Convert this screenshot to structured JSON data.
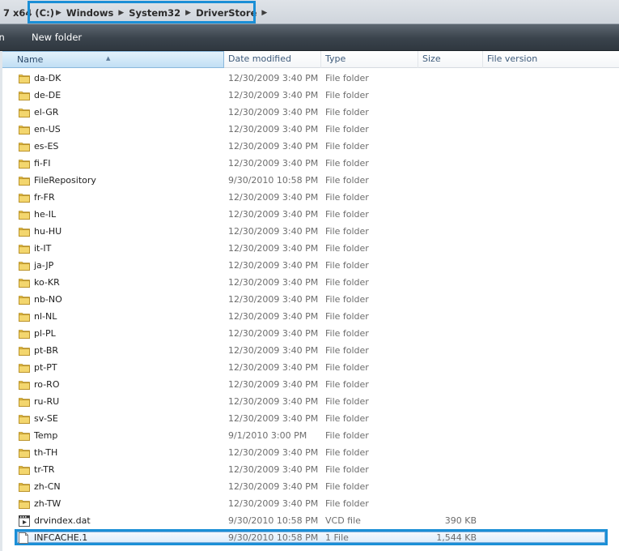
{
  "address": {
    "prefix": "7 x64 (C:)",
    "crumbs": [
      "Windows",
      "System32",
      "DriverStore"
    ]
  },
  "toolbar": {
    "left_fragment": "rn",
    "new_folder": "New folder"
  },
  "columns": {
    "name": "Name",
    "date": "Date modified",
    "type": "Type",
    "size": "Size",
    "version": "File version"
  },
  "files": [
    {
      "name": "da-DK",
      "date": "12/30/2009 3:40 PM",
      "type": "File folder",
      "size": "",
      "icon": "folder-icon"
    },
    {
      "name": "de-DE",
      "date": "12/30/2009 3:40 PM",
      "type": "File folder",
      "size": "",
      "icon": "folder-icon"
    },
    {
      "name": "el-GR",
      "date": "12/30/2009 3:40 PM",
      "type": "File folder",
      "size": "",
      "icon": "folder-icon"
    },
    {
      "name": "en-US",
      "date": "12/30/2009 3:40 PM",
      "type": "File folder",
      "size": "",
      "icon": "folder-icon"
    },
    {
      "name": "es-ES",
      "date": "12/30/2009 3:40 PM",
      "type": "File folder",
      "size": "",
      "icon": "folder-icon"
    },
    {
      "name": "fi-FI",
      "date": "12/30/2009 3:40 PM",
      "type": "File folder",
      "size": "",
      "icon": "folder-icon"
    },
    {
      "name": "FileRepository",
      "date": "9/30/2010 10:58 PM",
      "type": "File folder",
      "size": "",
      "icon": "folder-icon"
    },
    {
      "name": "fr-FR",
      "date": "12/30/2009 3:40 PM",
      "type": "File folder",
      "size": "",
      "icon": "folder-icon"
    },
    {
      "name": "he-IL",
      "date": "12/30/2009 3:40 PM",
      "type": "File folder",
      "size": "",
      "icon": "folder-icon"
    },
    {
      "name": "hu-HU",
      "date": "12/30/2009 3:40 PM",
      "type": "File folder",
      "size": "",
      "icon": "folder-icon"
    },
    {
      "name": "it-IT",
      "date": "12/30/2009 3:40 PM",
      "type": "File folder",
      "size": "",
      "icon": "folder-icon"
    },
    {
      "name": "ja-JP",
      "date": "12/30/2009 3:40 PM",
      "type": "File folder",
      "size": "",
      "icon": "folder-icon"
    },
    {
      "name": "ko-KR",
      "date": "12/30/2009 3:40 PM",
      "type": "File folder",
      "size": "",
      "icon": "folder-icon"
    },
    {
      "name": "nb-NO",
      "date": "12/30/2009 3:40 PM",
      "type": "File folder",
      "size": "",
      "icon": "folder-icon"
    },
    {
      "name": "nl-NL",
      "date": "12/30/2009 3:40 PM",
      "type": "File folder",
      "size": "",
      "icon": "folder-icon"
    },
    {
      "name": "pl-PL",
      "date": "12/30/2009 3:40 PM",
      "type": "File folder",
      "size": "",
      "icon": "folder-icon"
    },
    {
      "name": "pt-BR",
      "date": "12/30/2009 3:40 PM",
      "type": "File folder",
      "size": "",
      "icon": "folder-icon"
    },
    {
      "name": "pt-PT",
      "date": "12/30/2009 3:40 PM",
      "type": "File folder",
      "size": "",
      "icon": "folder-icon"
    },
    {
      "name": "ro-RO",
      "date": "12/30/2009 3:40 PM",
      "type": "File folder",
      "size": "",
      "icon": "folder-icon"
    },
    {
      "name": "ru-RU",
      "date": "12/30/2009 3:40 PM",
      "type": "File folder",
      "size": "",
      "icon": "folder-icon"
    },
    {
      "name": "sv-SE",
      "date": "12/30/2009 3:40 PM",
      "type": "File folder",
      "size": "",
      "icon": "folder-icon"
    },
    {
      "name": "Temp",
      "date": "9/1/2010 3:00 PM",
      "type": "File folder",
      "size": "",
      "icon": "folder-icon"
    },
    {
      "name": "th-TH",
      "date": "12/30/2009 3:40 PM",
      "type": "File folder",
      "size": "",
      "icon": "folder-icon"
    },
    {
      "name": "tr-TR",
      "date": "12/30/2009 3:40 PM",
      "type": "File folder",
      "size": "",
      "icon": "folder-icon"
    },
    {
      "name": "zh-CN",
      "date": "12/30/2009 3:40 PM",
      "type": "File folder",
      "size": "",
      "icon": "folder-icon"
    },
    {
      "name": "zh-TW",
      "date": "12/30/2009 3:40 PM",
      "type": "File folder",
      "size": "",
      "icon": "folder-icon"
    },
    {
      "name": "drvindex.dat",
      "date": "9/30/2010 10:58 PM",
      "type": "VCD file",
      "size": "390 KB",
      "icon": "media-file-icon"
    },
    {
      "name": "INFCACHE.1",
      "date": "9/30/2010 10:58 PM",
      "type": "1 File",
      "size": "1,544 KB",
      "icon": "blank-file-icon",
      "selected": true
    }
  ],
  "colors": {
    "highlight": "#1b8fd6",
    "folder": "#e8c24a",
    "toolbar": "#3a434c"
  }
}
